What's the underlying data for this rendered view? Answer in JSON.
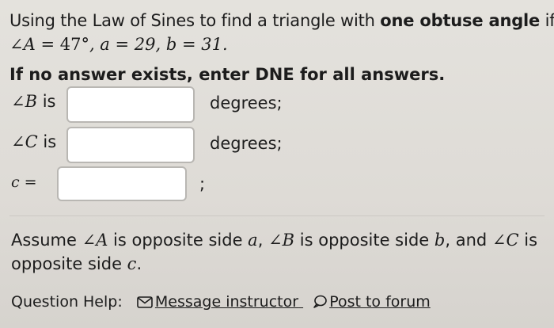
{
  "question": {
    "line1_prefix": "Using the Law of Sines to find a triangle with ",
    "line1_bold": "one obtuse angle",
    "line1_suffix": " if",
    "given_A_label": "∠A",
    "given_A_value": "= 47°",
    "given_a": ", a = 29,",
    "given_b": "b = 31.",
    "instruction": "If no answer exists, enter DNE for all answers."
  },
  "answers": {
    "angle_B_label": "∠B",
    "angle_B_is": "is",
    "angle_B_unit": "degrees;",
    "angle_B_value": "",
    "angle_C_label": "∠C",
    "angle_C_is": "is",
    "angle_C_unit": "degrees;",
    "angle_C_value": "",
    "side_c_label": "c =",
    "side_c_suffix": ";",
    "side_c_value": ""
  },
  "assumption": {
    "p1": "Assume ",
    "angA": "∠A",
    "p2": " is opposite side ",
    "a": "a",
    "p3": ", ",
    "angB": "∠B",
    "p4": " is opposite side ",
    "b": "b",
    "p5": ", and ",
    "angC": "∠C",
    "p6": " is opposite side ",
    "c": "c",
    "p7": "."
  },
  "help": {
    "label": "Question Help:",
    "message_link": "Message instructor",
    "forum_link": "Post to forum"
  }
}
